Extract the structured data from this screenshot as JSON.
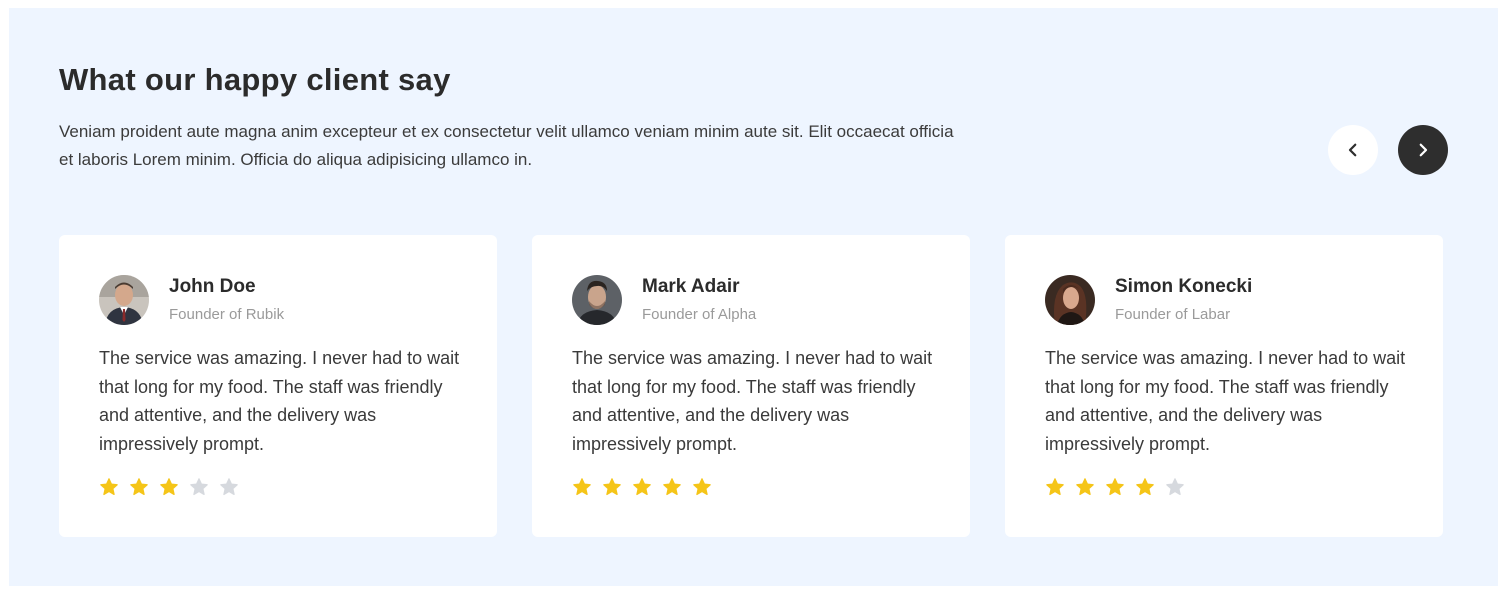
{
  "section": {
    "title": "What our happy client say",
    "description": "Veniam proident aute magna anim excepteur et ex consectetur velit ullamco veniam minim aute sit. Elit occaecat officia et laboris Lorem minim. Officia do aliqua adipisicing ullamco in."
  },
  "navigation": {
    "prev_icon": "chevron-left-icon",
    "next_icon": "chevron-right-icon"
  },
  "colors": {
    "background": "#eef5ff",
    "card": "#ffffff",
    "star_filled": "#f5c518",
    "star_empty": "#d6d9de",
    "next_button": "#2e2e2e"
  },
  "testimonials": [
    {
      "name": "John Doe",
      "role": "Founder of Rubik",
      "review": "The service was amazing. I never had to wait that long for my food. The staff was friendly and attentive, and the delivery was impressively prompt.",
      "rating": 3,
      "max_rating": 5
    },
    {
      "name": "Mark Adair",
      "role": "Founder of Alpha",
      "review": "The service was amazing. I never had to wait that long for my food. The staff was friendly and attentive, and the delivery was impressively prompt.",
      "rating": 5,
      "max_rating": 5
    },
    {
      "name": "Simon Konecki",
      "role": "Founder of Labar",
      "review": "The service was amazing. I never had to wait that long for my food. The staff was friendly and attentive, and the delivery was impressively prompt.",
      "rating": 4,
      "max_rating": 5
    }
  ]
}
